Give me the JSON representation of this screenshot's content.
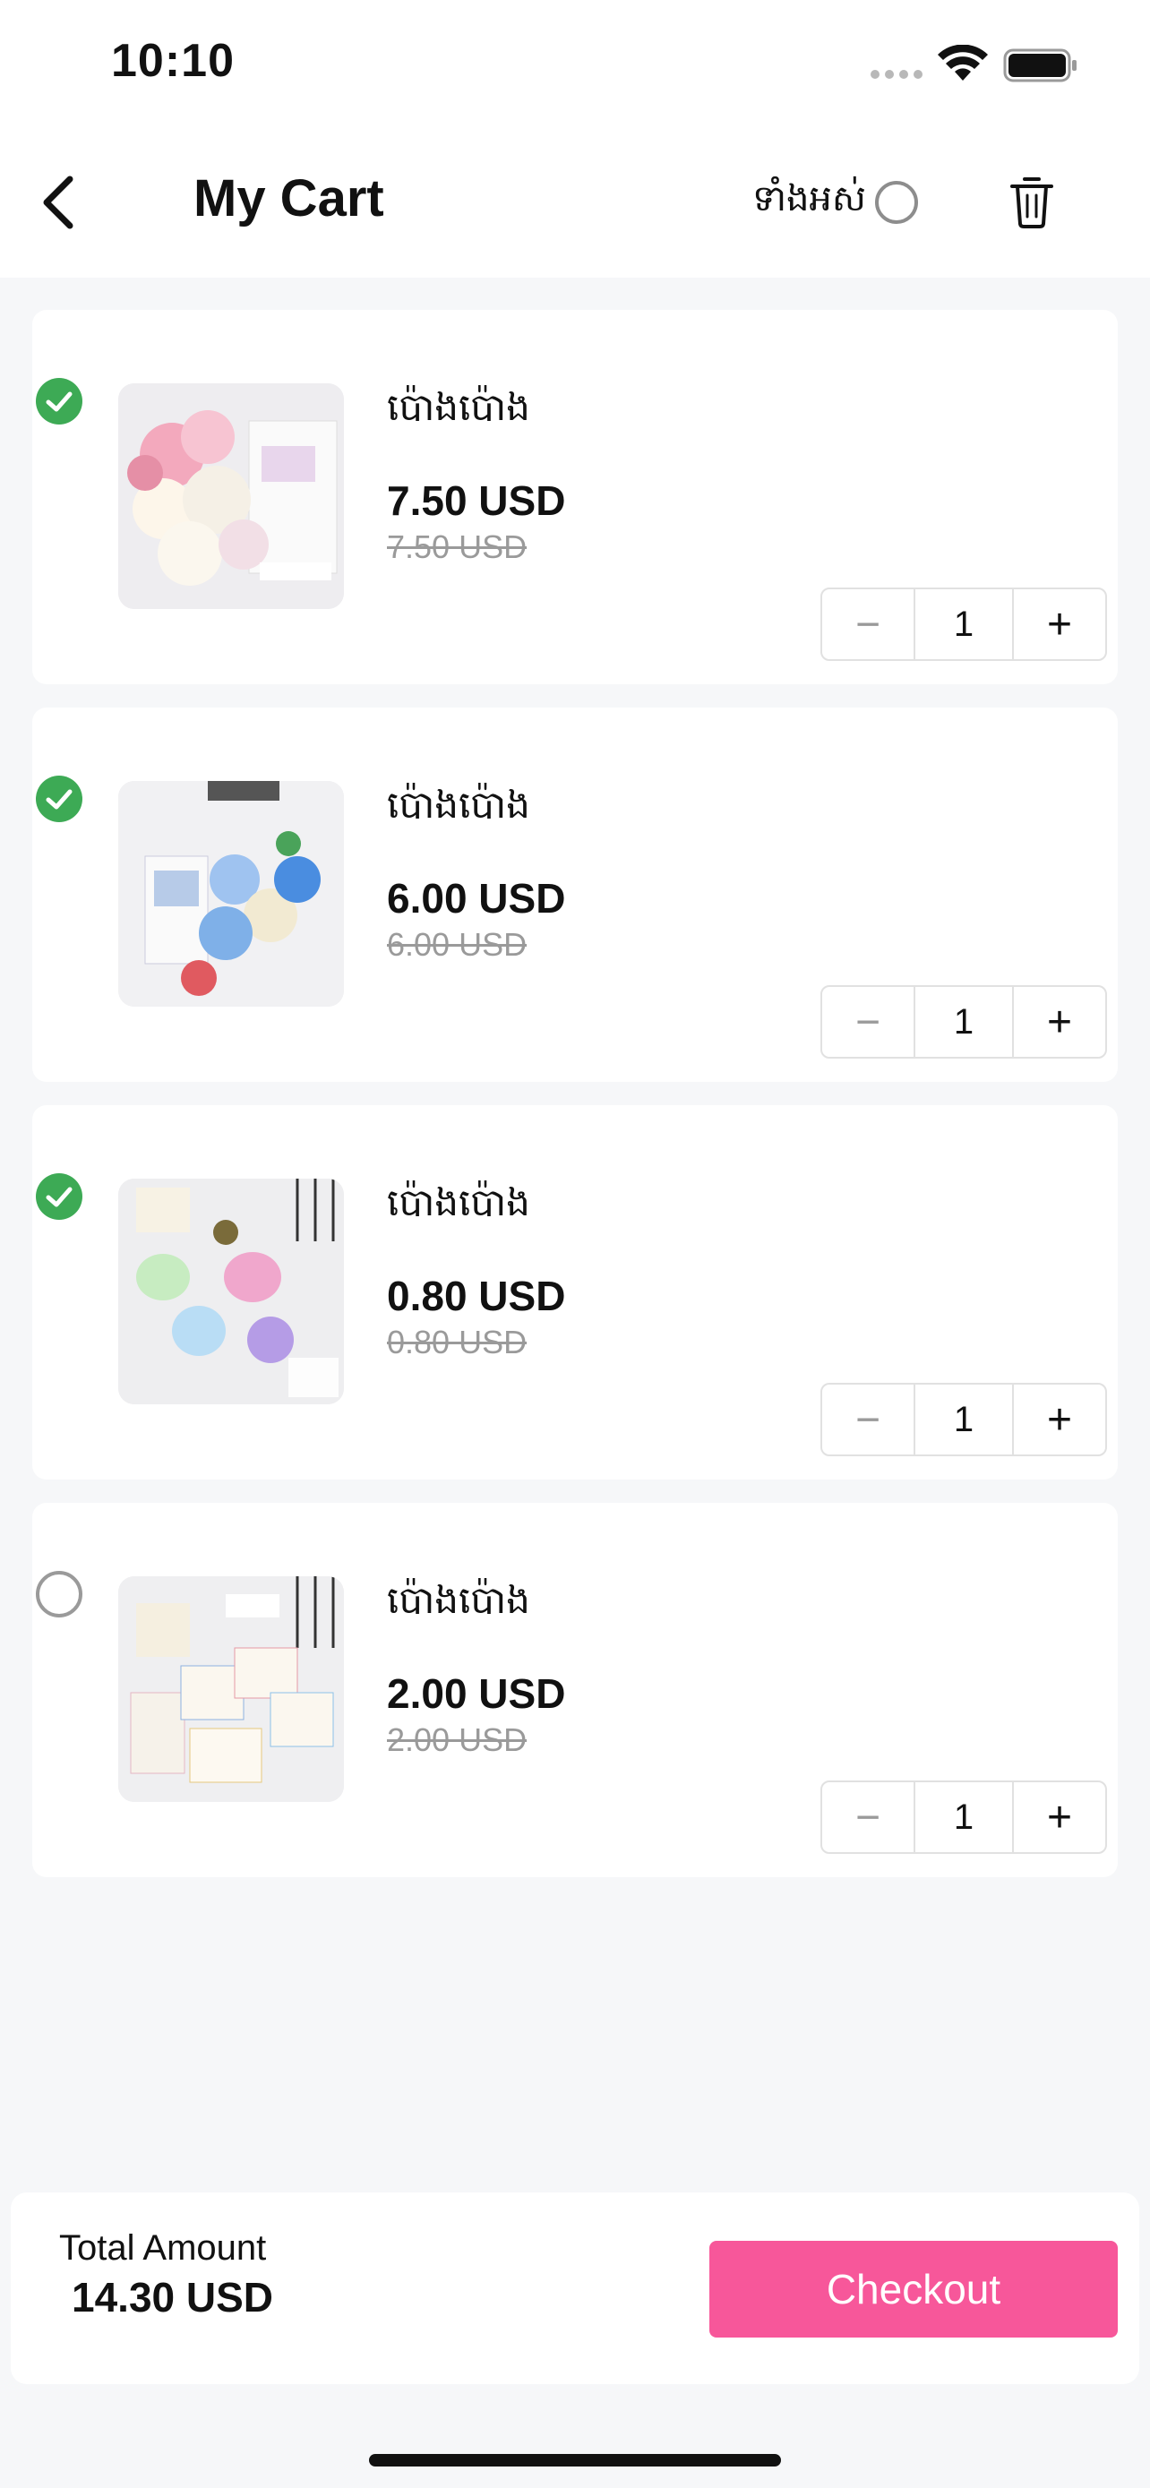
{
  "status_bar": {
    "time": "10:10"
  },
  "header": {
    "title": "My Cart",
    "select_all_label": "ទាំងអស់",
    "back_icon": "chevron-left-icon",
    "delete_icon": "trash-icon"
  },
  "items": [
    {
      "name": "ប៉ោងប៉ោង",
      "price": "7.50 USD",
      "old_price": "7.50 USD",
      "quantity": "1",
      "selected": true
    },
    {
      "name": "ប៉ោងប៉ោង",
      "price": "6.00 USD",
      "old_price": "6.00 USD",
      "quantity": "1",
      "selected": true
    },
    {
      "name": "ប៉ោងប៉ោង",
      "price": "0.80 USD",
      "old_price": "0.80 USD",
      "quantity": "1",
      "selected": true
    },
    {
      "name": "ប៉ោងប៉ោង",
      "price": "2.00 USD",
      "old_price": "2.00 USD",
      "quantity": "1",
      "selected": false
    }
  ],
  "stepper": {
    "minus": "−",
    "plus": "+"
  },
  "footer": {
    "total_label": "Total Amount",
    "total_value": "14.30 USD",
    "checkout_label": "Checkout"
  },
  "colors": {
    "accent": "#f7579a",
    "check": "#3daa55",
    "background": "#f6f7f9"
  }
}
